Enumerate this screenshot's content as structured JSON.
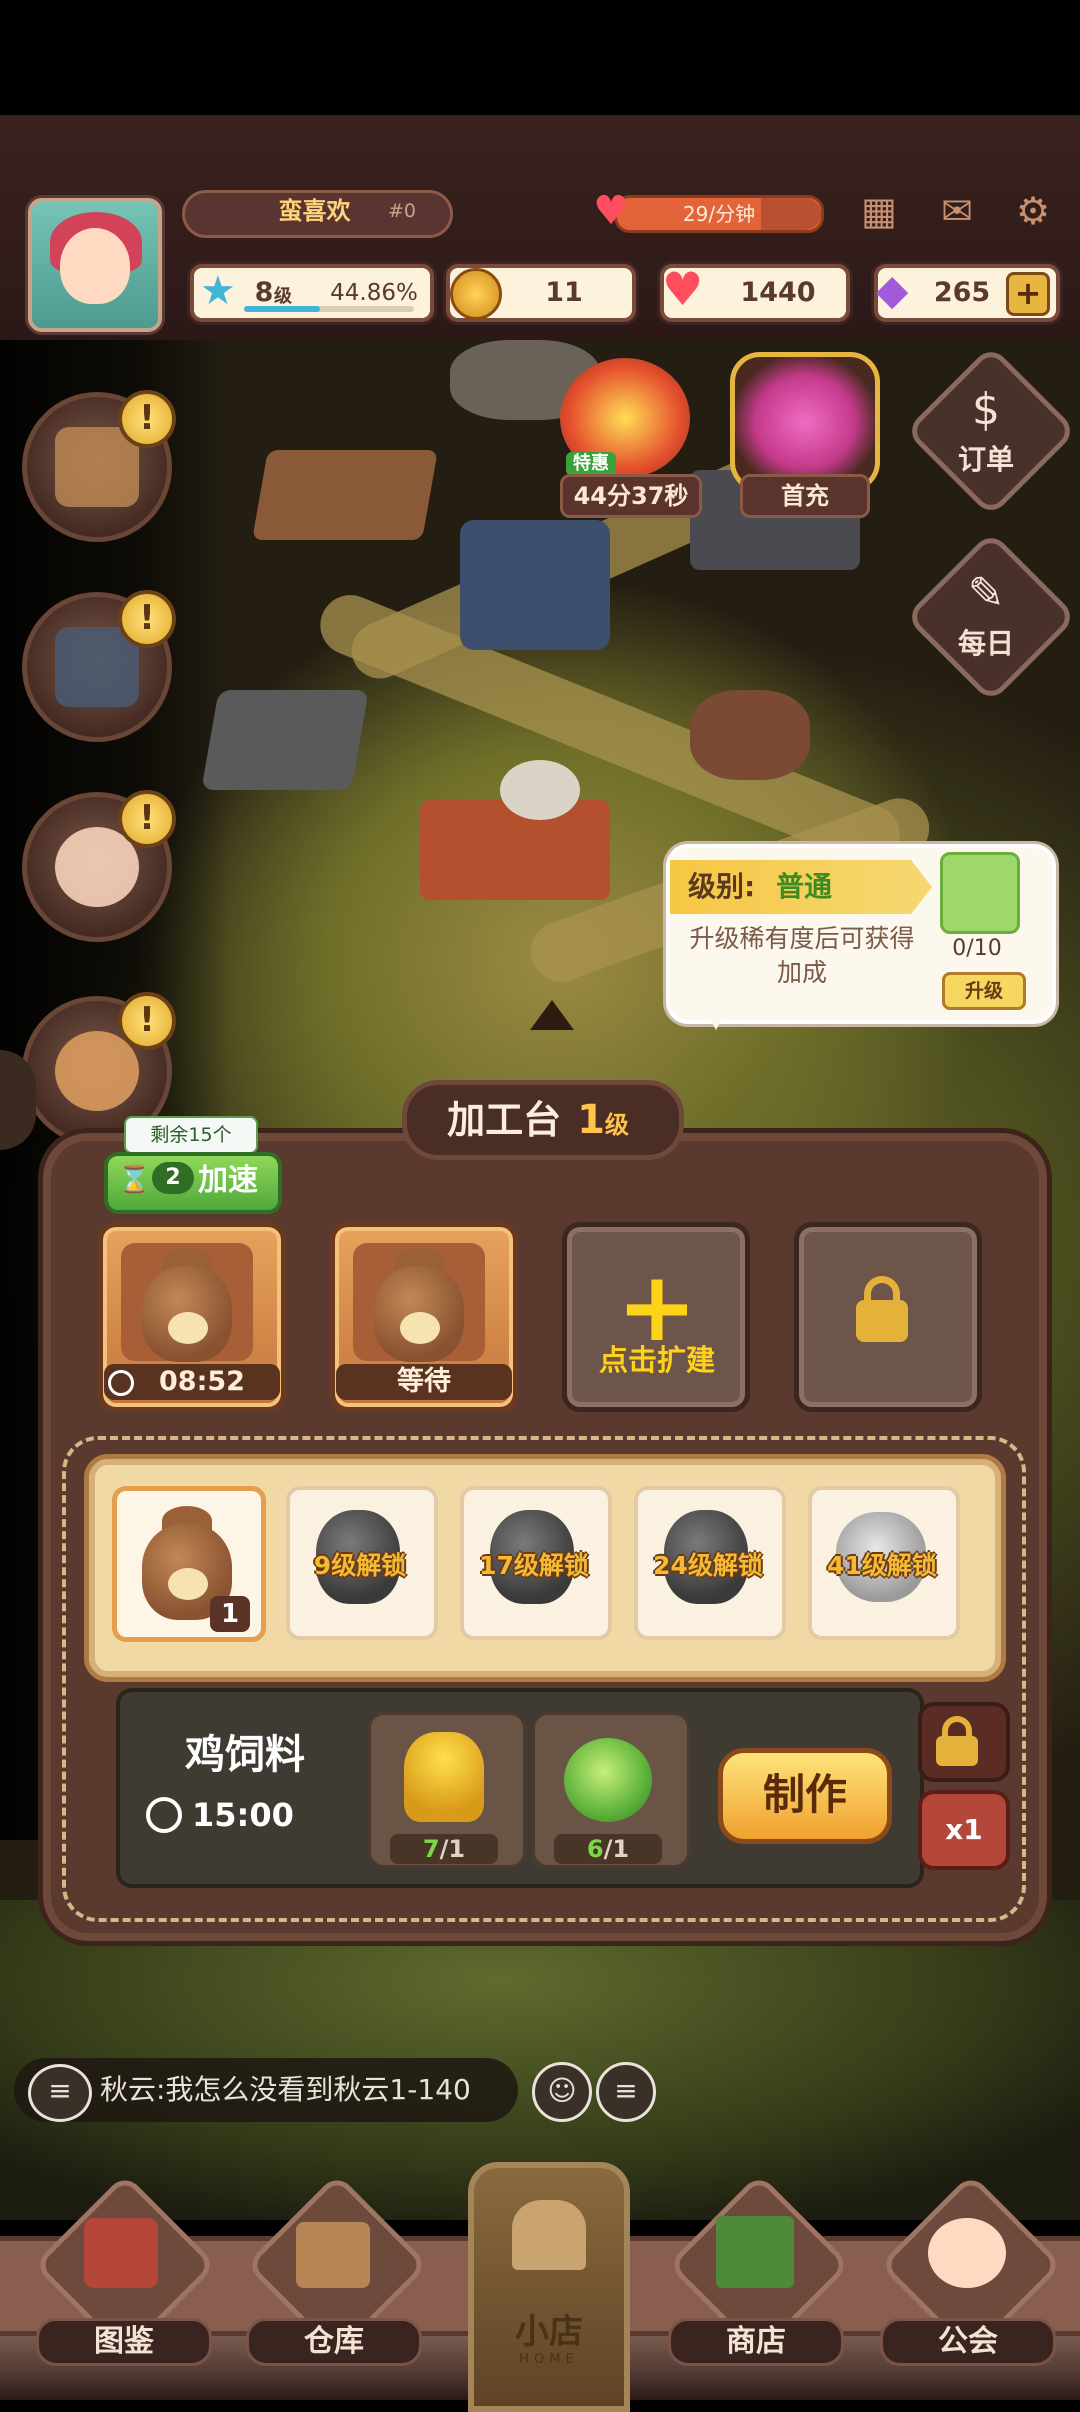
{
  "header": {
    "player_name": "蛮喜欢",
    "player_id": "#0",
    "heart_rate": "29/分钟",
    "level_num": "8",
    "level_unit": "级",
    "level_progress": "44.86%",
    "level_progress_value": 0.4486,
    "coins": "11",
    "hearts": "1440",
    "gems": "265",
    "plus": "+"
  },
  "events": {
    "limited_sale_tag": "特惠",
    "limited_timer": "44分37秒",
    "first_recharge": "首充"
  },
  "right_menu": {
    "orders": "订单",
    "daily": "每日"
  },
  "level_tip": {
    "label": "级别:",
    "value": "普通",
    "description": "升级稀有度后可获得加成",
    "progress": "0/10",
    "upgrade_button": "升级"
  },
  "panel": {
    "title": "加工台",
    "level_num": "1",
    "level_unit": "级",
    "speedup_remaining": "剩余15个",
    "speedup_count": "2",
    "speedup_label": "加速",
    "queue": [
      {
        "caption": "08:52",
        "state": "processing"
      },
      {
        "caption": "等待",
        "state": "waiting"
      },
      {
        "caption": "点击扩建",
        "state": "expand"
      },
      {
        "caption": "",
        "state": "locked"
      }
    ],
    "recipes": [
      {
        "label": "",
        "count": "1",
        "selected": true
      },
      {
        "label": "9级解锁"
      },
      {
        "label": "17级解锁"
      },
      {
        "label": "24级解锁"
      },
      {
        "label": "41级解锁"
      }
    ],
    "detail": {
      "name": "鸡饲料",
      "time": "15:00",
      "ingredients": [
        {
          "have": "7",
          "need": "/1",
          "icon": "wheat-icon"
        },
        {
          "have": "6",
          "need": "/1",
          "icon": "cabbage-icon"
        }
      ],
      "make_button": "制作",
      "quantity": "x1"
    }
  },
  "chat": {
    "message": "秋云:我怎么没看到秋云1-140"
  },
  "nav": {
    "items": [
      "图鉴",
      "仓库",
      "小店",
      "商店",
      "公会"
    ],
    "home_sub": "HOME"
  },
  "colors": {
    "accent_gold": "#ffc54a",
    "panel_brown": "#5a3a2e",
    "green_button": "#4fa83a",
    "rarity_green": "#3c8b23"
  }
}
